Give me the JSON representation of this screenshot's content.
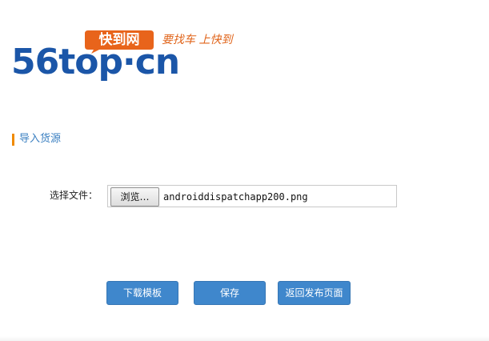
{
  "brand": {
    "logo_text": "56top·cn",
    "badge_text": "快到网",
    "slogan": "要找车 上快到",
    "primary_color": "#1b56a8",
    "badge_color": "#e8641b"
  },
  "section": {
    "title": "导入货源",
    "accent_color": "#f08a00"
  },
  "upload": {
    "label": "选择文件：",
    "browse_label": "浏览…",
    "file_name": "androiddispatchapp200.png"
  },
  "actions": {
    "download_template": "下载模板",
    "save": "保存",
    "back_to_publish": "返回发布页面",
    "button_color": "#3f87cc"
  }
}
